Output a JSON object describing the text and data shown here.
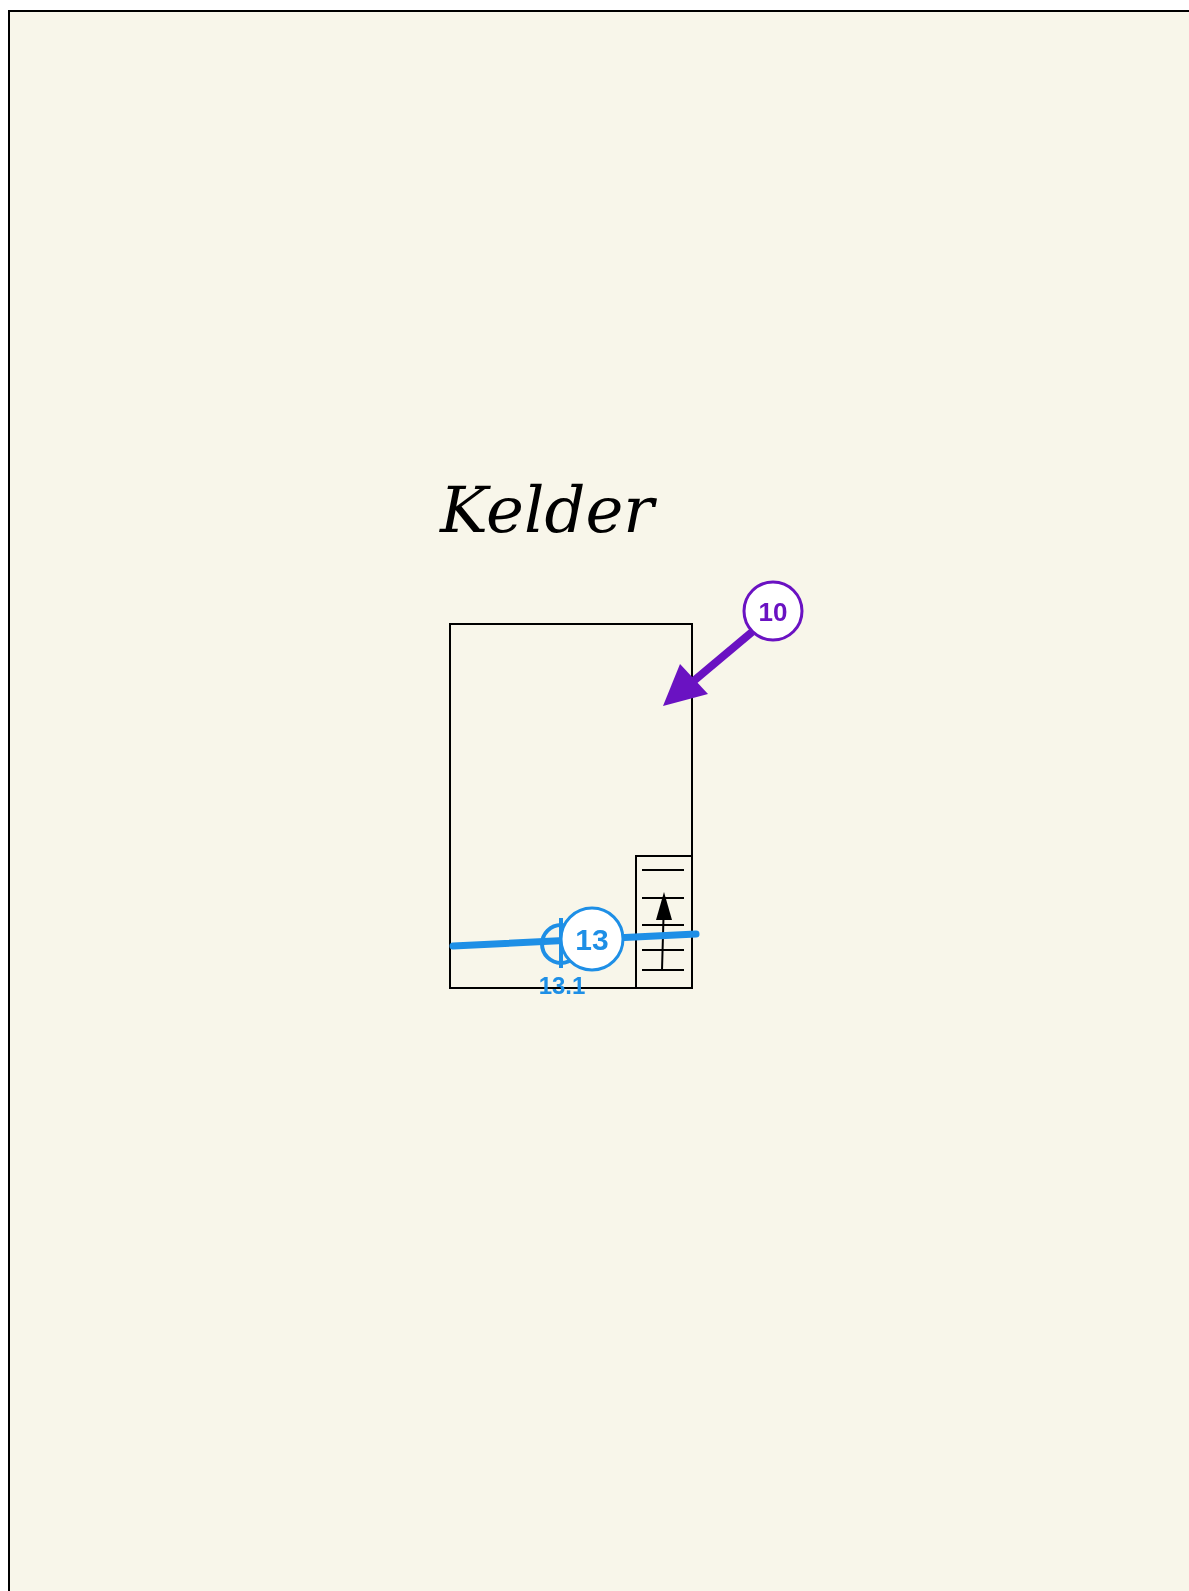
{
  "canvas": {
    "title": "Kelder",
    "markers": [
      {
        "kind": "arrow",
        "label": "10",
        "color": "#6a12c2"
      },
      {
        "kind": "line",
        "label": "13",
        "color": "#1e8fe6",
        "sub_label": "13.1"
      }
    ]
  }
}
